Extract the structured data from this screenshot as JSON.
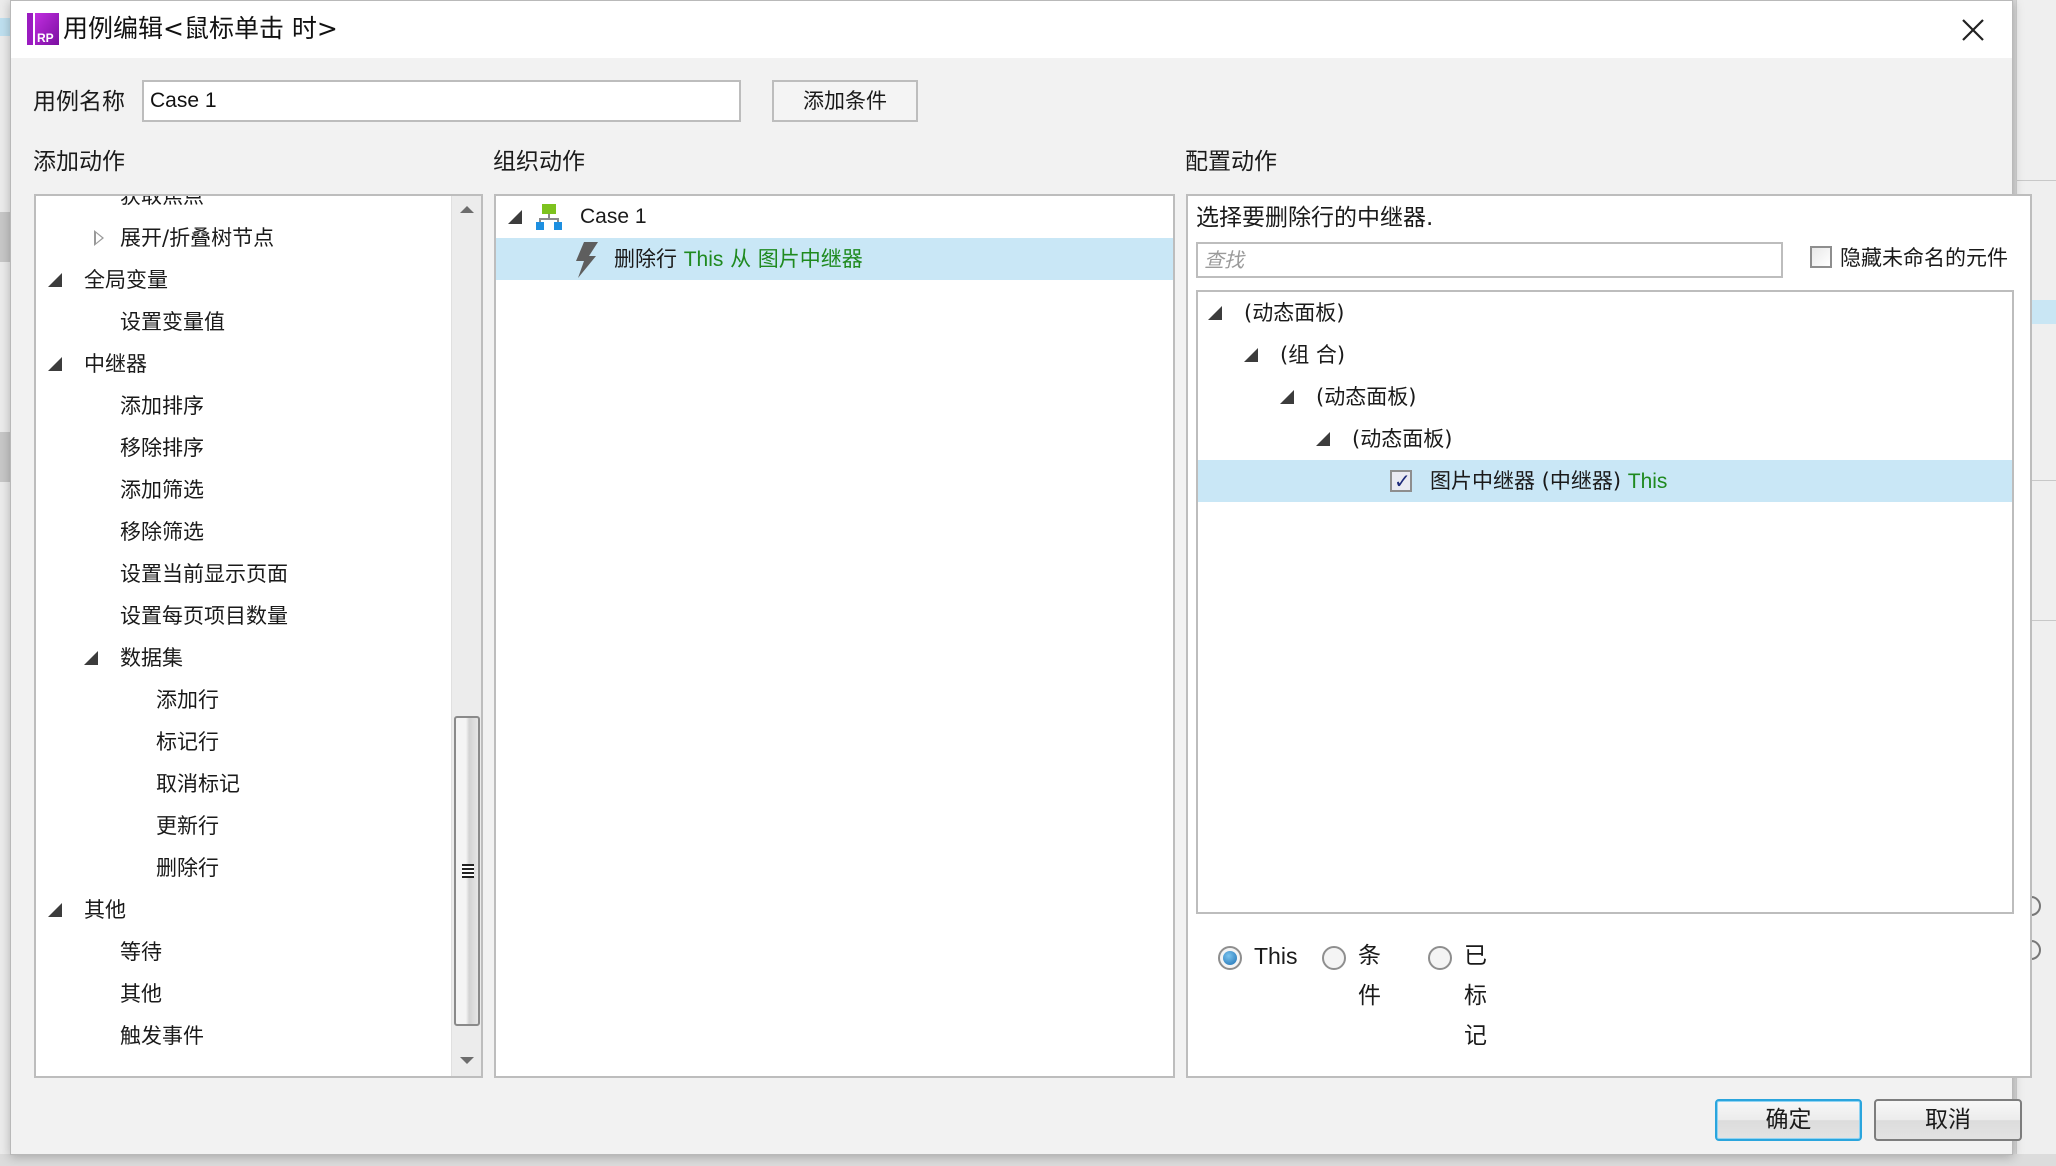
{
  "dialog": {
    "title": "用例编辑<鼠标单击 时>",
    "app_icon": "axure-rp-logo-icon",
    "close_icon": "close-icon"
  },
  "case_name": {
    "label": "用例名称",
    "value": "Case 1"
  },
  "add_condition_label": "添加条件",
  "sections": {
    "add_action": "添加动作",
    "organize_action": "组织动作",
    "configure_action": "配置动作"
  },
  "add_action_tree": [
    {
      "label": "获取焦点",
      "level": 2,
      "toggle": "none"
    },
    {
      "label": "展开/折叠树节点",
      "level": 2,
      "toggle": "collapsed"
    },
    {
      "label": "全局变量",
      "level": 1,
      "toggle": "expanded"
    },
    {
      "label": "设置变量值",
      "level": 2,
      "toggle": "none"
    },
    {
      "label": "中继器",
      "level": 1,
      "toggle": "expanded"
    },
    {
      "label": "添加排序",
      "level": 2,
      "toggle": "none"
    },
    {
      "label": "移除排序",
      "level": 2,
      "toggle": "none"
    },
    {
      "label": "添加筛选",
      "level": 2,
      "toggle": "none"
    },
    {
      "label": "移除筛选",
      "level": 2,
      "toggle": "none"
    },
    {
      "label": "设置当前显示页面",
      "level": 2,
      "toggle": "none"
    },
    {
      "label": "设置每页项目数量",
      "level": 2,
      "toggle": "none"
    },
    {
      "label": "数据集",
      "level": 2,
      "toggle": "expanded"
    },
    {
      "label": "添加行",
      "level": 3,
      "toggle": "none"
    },
    {
      "label": "标记行",
      "level": 3,
      "toggle": "none"
    },
    {
      "label": "取消标记",
      "level": 3,
      "toggle": "none"
    },
    {
      "label": "更新行",
      "level": 3,
      "toggle": "none"
    },
    {
      "label": "删除行",
      "level": 3,
      "toggle": "none"
    },
    {
      "label": "其他",
      "level": 1,
      "toggle": "expanded"
    },
    {
      "label": "等待",
      "level": 2,
      "toggle": "none"
    },
    {
      "label": "其他",
      "level": 2,
      "toggle": "none"
    },
    {
      "label": "触发事件",
      "level": 2,
      "toggle": "none"
    }
  ],
  "add_action_scroll": {
    "position_fraction": 0.62,
    "visible_fraction": 0.36
  },
  "organize_tree": {
    "case_label": "Case 1",
    "case_icon": "case-hierarchy-icon",
    "action": {
      "icon": "lightning-icon",
      "verb": "删除行",
      "target_this": "This",
      "from": "从",
      "repeater": "图片中继器"
    }
  },
  "configure": {
    "hint": "选择要删除行的中继器.",
    "search_placeholder": "查找",
    "hide_unnamed_label": "隐藏未命名的元件",
    "hide_unnamed_checked": false,
    "widget_tree": [
      {
        "label": "(动态面板)",
        "level": 0
      },
      {
        "label": "(组 合)",
        "level": 1
      },
      {
        "label": "(动态面板)",
        "level": 2
      },
      {
        "label": "(动态面板)",
        "level": 3
      }
    ],
    "selected_widget": {
      "label": "图片中继器 (中继器)",
      "tag": "This",
      "checked": true
    },
    "radio_options": [
      {
        "label": "This",
        "selected": true
      },
      {
        "label": "条件",
        "selected": false
      },
      {
        "label": "已标记",
        "selected": false
      }
    ]
  },
  "footer": {
    "ok_label": "确定",
    "cancel_label": "取消"
  },
  "colors": {
    "accent_green": "#1f8a1f",
    "selection": "#c9e7f6",
    "ok_focus": "#2aa5dd"
  }
}
